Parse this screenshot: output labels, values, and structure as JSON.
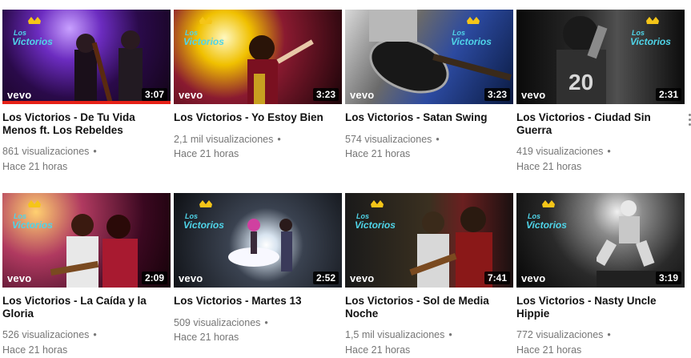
{
  "videos": [
    {
      "title": "Los Victorios - De Tu Vida Menos ft. Los Rebeldes",
      "views": "861 visualizaciones",
      "age": "Hace 21 horas",
      "duration": "3:07",
      "brand": "vevo",
      "watched": true
    },
    {
      "title": "Los Victorios - Yo Estoy Bien",
      "views": "2,1 mil visualizaciones",
      "age": "Hace 21 horas",
      "duration": "3:23",
      "brand": "vevo",
      "watched": false
    },
    {
      "title": "Los Victorios - Satan Swing",
      "views": "574 visualizaciones",
      "age": "Hace 21 horas",
      "duration": "3:23",
      "brand": "vevo",
      "watched": false
    },
    {
      "title": "Los Victorios - Ciudad Sin Guerra",
      "views": "419 visualizaciones",
      "age": "Hace 21 horas",
      "duration": "2:31",
      "brand": "vevo",
      "watched": false
    },
    {
      "title": "Los Victorios - La Caída y la Gloria",
      "views": "526 visualizaciones",
      "age": "Hace 21 horas",
      "duration": "2:09",
      "brand": "vevo",
      "watched": false
    },
    {
      "title": "Los Victorios - Martes 13",
      "views": "509 visualizaciones",
      "age": "Hace 21 horas",
      "duration": "2:52",
      "brand": "vevo",
      "watched": false
    },
    {
      "title": "Los Victorios - Sol de Media Noche",
      "views": "1,5 mil visualizaciones",
      "age": "Hace 21 horas",
      "duration": "7:41",
      "brand": "vevo",
      "watched": false
    },
    {
      "title": "Los Victorios - Nasty Uncle Hippie",
      "views": "772 visualizaciones",
      "age": "Hace 21 horas",
      "duration": "3:19",
      "brand": "vevo",
      "watched": false
    }
  ],
  "separator": "•",
  "logo_text": "Los Victorios",
  "colors": {
    "progress": "#e62117",
    "title": "#111111",
    "meta": "#767676",
    "logo": "#4fd4e8",
    "crown": "#f5c518"
  }
}
